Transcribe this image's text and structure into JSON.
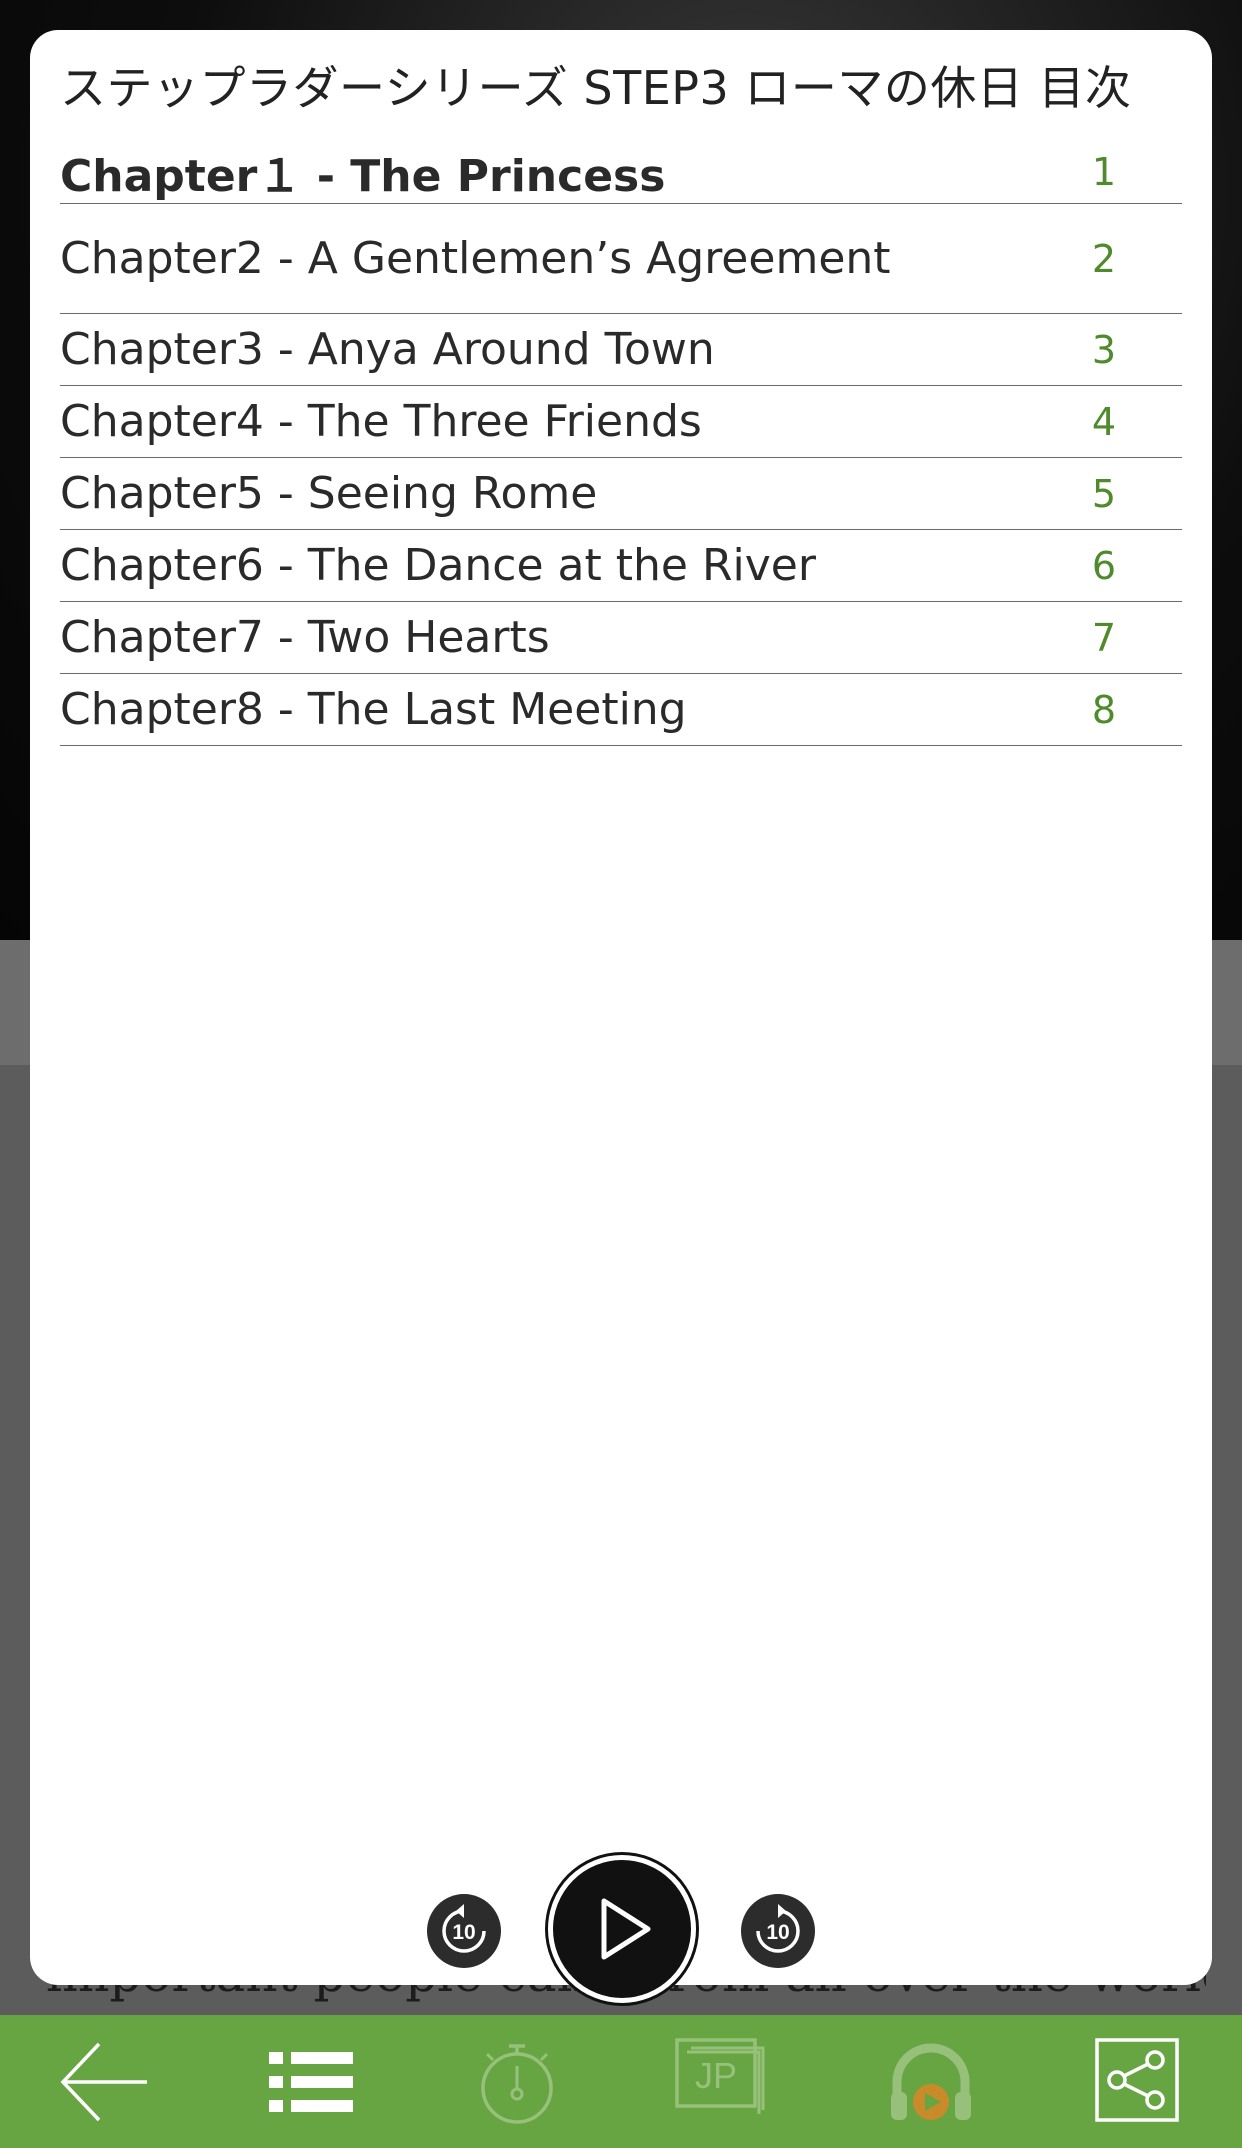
{
  "background": {
    "page_text": "important people came from all over the world"
  },
  "toc": {
    "title": "ステップラダーシリーズ STEP3 ローマの休日 目次",
    "chapters": [
      {
        "label": "Chapter１ - The Princess",
        "page": "1",
        "current": true
      },
      {
        "label": "Chapter2 - A Gentlemen’s Agreement",
        "page": "2",
        "current": false
      },
      {
        "label": "Chapter3 - Anya Around Town",
        "page": "3",
        "current": false
      },
      {
        "label": "Chapter4 - The Three Friends",
        "page": "4",
        "current": false
      },
      {
        "label": "Chapter5 - Seeing Rome",
        "page": "5",
        "current": false
      },
      {
        "label": "Chapter6 - The Dance at the River",
        "page": "6",
        "current": false
      },
      {
        "label": "Chapter7 - Two Hearts",
        "page": "7",
        "current": false
      },
      {
        "label": "Chapter8 - The Last Meeting",
        "page": "8",
        "current": false
      }
    ]
  },
  "player": {
    "rewind_seconds": "10",
    "forward_seconds": "10",
    "play_icon": "play-icon"
  },
  "toolbar": {
    "language_label": "JP",
    "icons": [
      "back-arrow-icon",
      "list-icon",
      "timer-icon",
      "language-icon",
      "audio-headphones-icon",
      "share-icon"
    ]
  },
  "colors": {
    "accent_green": "#67a543",
    "page_number_green": "#4f8a2b",
    "inactive_icon": "#97c17a",
    "audio_play_orange": "#c98a2a"
  }
}
